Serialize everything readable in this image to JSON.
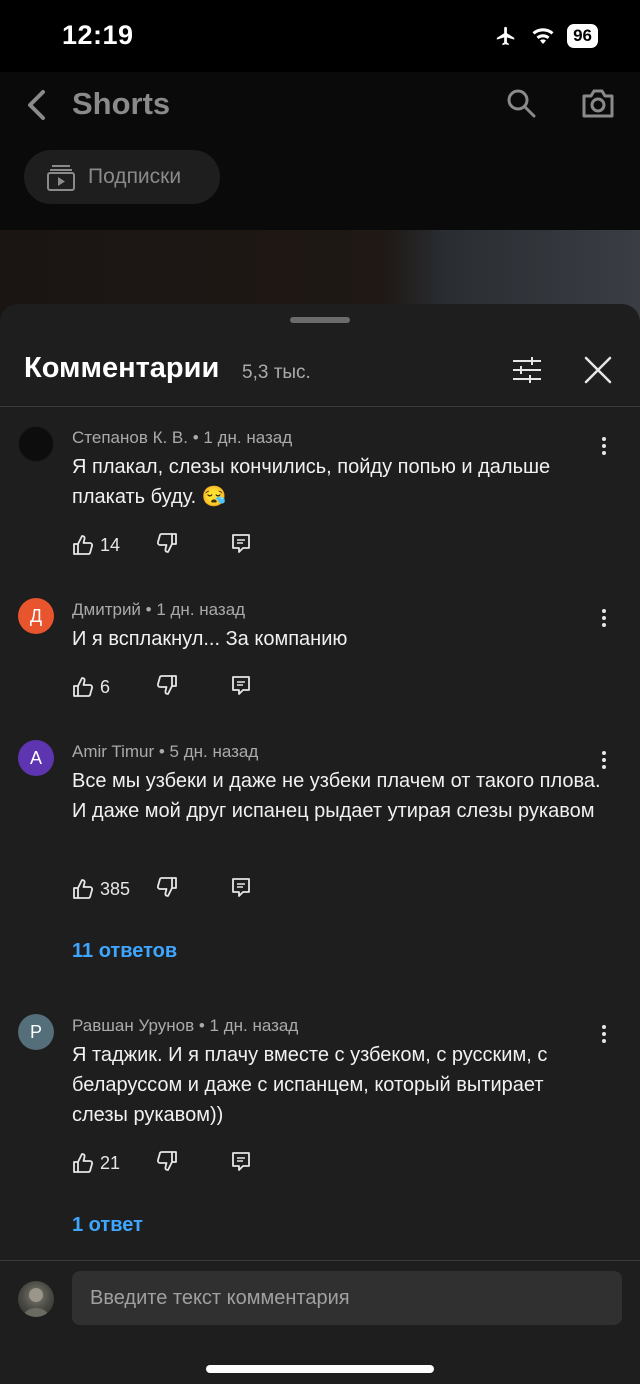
{
  "status_bar": {
    "time": "12:19",
    "battery": "96"
  },
  "header": {
    "title": "Shorts",
    "subscriptions_chip": "Подписки"
  },
  "sheet": {
    "title": "Комментарии",
    "count": "5,3 тыс."
  },
  "comments": [
    {
      "author": "Степанов К. В.",
      "time": "1 дн. назад",
      "meta": "Степанов К. В. • 1 дн. назад",
      "avatar_letter": "",
      "avatar_color": "#0d0d0d",
      "text": "Я плакал, слезы кончились, пойду попью и дальше плакать буду. 😪",
      "likes": "14"
    },
    {
      "author": "Дмитрий",
      "time": "1 дн. назад",
      "meta": "Дмитрий • 1 дн. назад",
      "avatar_letter": "Д",
      "avatar_color": "#e8552d",
      "text": "И я всплакнул... За компанию",
      "likes": "6"
    },
    {
      "author": "Amir Timur",
      "time": "5 дн. назад",
      "meta": "Amir Timur • 5 дн. назад",
      "avatar_letter": "A",
      "avatar_color": "#5e35b1",
      "text": "Все мы узбеки и даже не узбеки плачем от такого плова. И даже мой друг испанец рыдает утирая слезы рукавом",
      "likes": "385",
      "replies": "11 ответов"
    },
    {
      "author": "Равшан Урунов",
      "time": "1 дн. назад",
      "meta": "Равшан Урунов • 1 дн. назад",
      "avatar_letter": "Р",
      "avatar_color": "#546e7a",
      "text": "Я таджик. И я плачу вместе с узбеком, с русским, с беларуссом и даже с испанцем, который вытирает слезы рукавом))",
      "likes": "21",
      "replies": "1 ответ"
    }
  ],
  "input": {
    "placeholder": "Введите текст комментария"
  },
  "colors": {
    "accent_link": "#3ea6ff",
    "sheet_bg": "#1e1e1e"
  }
}
